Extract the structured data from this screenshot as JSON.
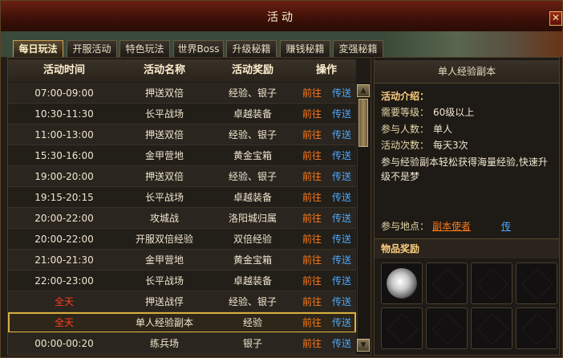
{
  "window": {
    "title": "活动",
    "close_glyph": "✕"
  },
  "tabs": [
    "每日玩法",
    "开服活动",
    "特色玩法",
    "世界Boss",
    "升级秘籍",
    "赚钱秘籍",
    "変强秘籍"
  ],
  "active_tab": 0,
  "table": {
    "headers": {
      "time": "活动时间",
      "name": "活动名称",
      "reward": "活动奖励",
      "ops": "操作"
    },
    "go_label": "前往",
    "teleport_label": "传送",
    "rows": [
      {
        "time": "07:00-09:00",
        "name": "押送双倍",
        "reward": "经验、银子"
      },
      {
        "time": "10:30-11:30",
        "name": "长平战场",
        "reward": "卓越装备"
      },
      {
        "time": "11:00-13:00",
        "name": "押送双倍",
        "reward": "经验、银子"
      },
      {
        "time": "15:30-16:00",
        "name": "金甲营地",
        "reward": "黄金宝箱"
      },
      {
        "time": "19:00-20:00",
        "name": "押送双倍",
        "reward": "经验、银子"
      },
      {
        "time": "19:15-20:15",
        "name": "长平战场",
        "reward": "卓越装备"
      },
      {
        "time": "20:00-22:00",
        "name": "攻城战",
        "reward": "洛阳城归属"
      },
      {
        "time": "20:00-22:00",
        "name": "开服双倍经验",
        "reward": "双倍经验"
      },
      {
        "time": "21:00-21:30",
        "name": "金甲营地",
        "reward": "黄金宝箱"
      },
      {
        "time": "22:00-23:00",
        "name": "长平战场",
        "reward": "卓越装备"
      },
      {
        "time": "全天",
        "name": "押送战俘",
        "reward": "经验、银子"
      },
      {
        "time": "全天",
        "name": "单人经验副本",
        "reward": "经验"
      },
      {
        "time": "00:00-00:20",
        "name": "练兵场",
        "reward": "银子"
      }
    ],
    "selected_row": 11,
    "scroll_up": "▲",
    "scroll_down": "▼"
  },
  "detail": {
    "title": "单人经验副本",
    "intro_label": "活动介绍：",
    "level_label": "需要等级：",
    "level_value": "60级以上",
    "people_label": "参与人数：",
    "people_value": "单人",
    "count_label": "活动次数：",
    "count_value": "每天3次",
    "description": "参与经验副本轻松获得海量经验,快速升级不是梦",
    "location_label": "参与地点：",
    "location_value": "副本使者",
    "location_teleport": "传"
  },
  "rewards": {
    "title": "物品奖励",
    "slots": 8,
    "filled": [
      0
    ]
  },
  "colors": {
    "accent_gold": "#d8b040",
    "go": "#ff7a1a",
    "teleport": "#4aa8ff",
    "all_day": "#ff3c24"
  }
}
